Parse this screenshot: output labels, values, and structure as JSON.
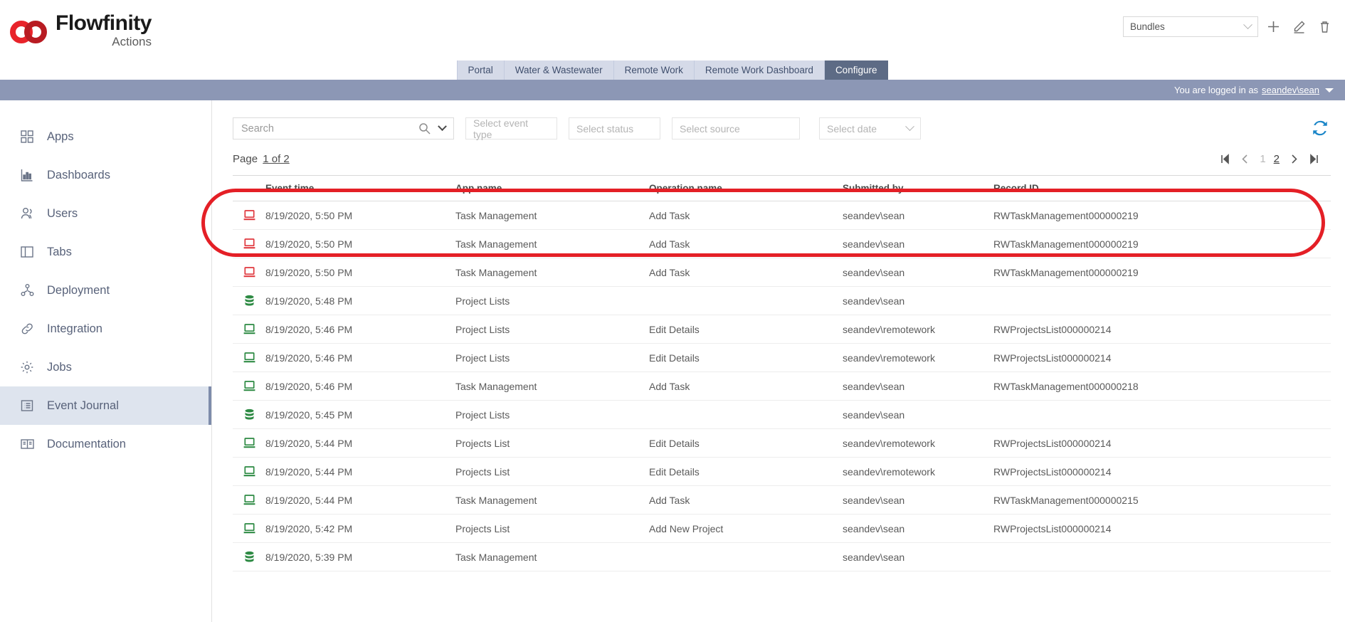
{
  "header": {
    "logo_word": "Flowfinity",
    "logo_sub": "Actions",
    "bundle_label": "Bundles",
    "icons": {
      "add": "plus-icon",
      "edit": "pencil-icon",
      "delete": "trash-icon"
    }
  },
  "tabs": [
    {
      "label": "Portal",
      "active": false
    },
    {
      "label": "Water & Wastewater",
      "active": false
    },
    {
      "label": "Remote Work",
      "active": false
    },
    {
      "label": "Remote Work Dashboard",
      "active": false
    },
    {
      "label": "Configure",
      "active": true
    }
  ],
  "loginbar": {
    "prefix": "You are logged in as",
    "user": "seandev\\sean"
  },
  "sidebar": {
    "items": [
      {
        "label": "Apps",
        "icon": "apps-grid-icon",
        "active": false
      },
      {
        "label": "Dashboards",
        "icon": "bar-chart-icon",
        "active": false
      },
      {
        "label": "Users",
        "icon": "users-icon",
        "active": false
      },
      {
        "label": "Tabs",
        "icon": "layout-panel-icon",
        "active": false
      },
      {
        "label": "Deployment",
        "icon": "deployment-hierarchy-icon",
        "active": false
      },
      {
        "label": "Integration",
        "icon": "link-chain-icon",
        "active": false
      },
      {
        "label": "Jobs",
        "icon": "gear-icon",
        "active": false
      },
      {
        "label": "Event Journal",
        "icon": "list-journal-icon",
        "active": true
      },
      {
        "label": "Documentation",
        "icon": "book-icon",
        "active": false
      }
    ]
  },
  "filters": {
    "search_placeholder": "Search",
    "event_type_placeholder": "Select event type",
    "status_placeholder": "Select status",
    "source_placeholder": "Select source",
    "date_placeholder": "Select date",
    "refresh_icon": "refresh-icon"
  },
  "pagination": {
    "page_label": "Page",
    "page_of": "1 of 2",
    "pages": [
      {
        "label": "1",
        "current": true
      },
      {
        "label": "2",
        "current": false
      }
    ]
  },
  "table": {
    "columns": [
      "",
      "Event time",
      "App name",
      "Operation name",
      "Submitted by",
      "Record ID"
    ],
    "rows": [
      {
        "icon": "desktop-icon",
        "color": "#e0393f",
        "time": "8/19/2020, 5:50 PM",
        "app": "Task Management",
        "operation": "Add Task",
        "submitted_by": "seandev\\sean",
        "record_id": "RWTaskManagement000000219"
      },
      {
        "icon": "desktop-icon",
        "color": "#e0393f",
        "time": "8/19/2020, 5:50 PM",
        "app": "Task Management",
        "operation": "Add Task",
        "submitted_by": "seandev\\sean",
        "record_id": "RWTaskManagement000000219"
      },
      {
        "icon": "desktop-icon",
        "color": "#e0393f",
        "time": "8/19/2020, 5:50 PM",
        "app": "Task Management",
        "operation": "Add Task",
        "submitted_by": "seandev\\sean",
        "record_id": "RWTaskManagement000000219"
      },
      {
        "icon": "database-icon",
        "color": "#2d8a43",
        "time": "8/19/2020, 5:48 PM",
        "app": "Project Lists",
        "operation": "",
        "submitted_by": "seandev\\sean",
        "record_id": ""
      },
      {
        "icon": "desktop-icon",
        "color": "#2d8a43",
        "time": "8/19/2020, 5:46 PM",
        "app": "Project Lists",
        "operation": "Edit Details",
        "submitted_by": "seandev\\remotework",
        "record_id": "RWProjectsList000000214"
      },
      {
        "icon": "desktop-icon",
        "color": "#2d8a43",
        "time": "8/19/2020, 5:46 PM",
        "app": "Project Lists",
        "operation": "Edit Details",
        "submitted_by": "seandev\\remotework",
        "record_id": "RWProjectsList000000214"
      },
      {
        "icon": "desktop-icon",
        "color": "#2d8a43",
        "time": "8/19/2020, 5:46 PM",
        "app": "Task Management",
        "operation": "Add Task",
        "submitted_by": "seandev\\sean",
        "record_id": "RWTaskManagement000000218"
      },
      {
        "icon": "database-icon",
        "color": "#2d8a43",
        "time": "8/19/2020, 5:45 PM",
        "app": "Project Lists",
        "operation": "",
        "submitted_by": "seandev\\sean",
        "record_id": ""
      },
      {
        "icon": "desktop-icon",
        "color": "#2d8a43",
        "time": "8/19/2020, 5:44 PM",
        "app": "Projects List",
        "operation": "Edit Details",
        "submitted_by": "seandev\\remotework",
        "record_id": "RWProjectsList000000214"
      },
      {
        "icon": "desktop-icon",
        "color": "#2d8a43",
        "time": "8/19/2020, 5:44 PM",
        "app": "Projects List",
        "operation": "Edit Details",
        "submitted_by": "seandev\\remotework",
        "record_id": "RWProjectsList000000214"
      },
      {
        "icon": "desktop-icon",
        "color": "#2d8a43",
        "time": "8/19/2020, 5:44 PM",
        "app": "Task Management",
        "operation": "Add Task",
        "submitted_by": "seandev\\sean",
        "record_id": "RWTaskManagement000000215"
      },
      {
        "icon": "desktop-icon",
        "color": "#2d8a43",
        "time": "8/19/2020, 5:42 PM",
        "app": "Projects List",
        "operation": "Add New Project",
        "submitted_by": "seandev\\sean",
        "record_id": "RWProjectsList000000214"
      },
      {
        "icon": "database-icon",
        "color": "#2d8a43",
        "time": "8/19/2020, 5:39 PM",
        "app": "Task Management",
        "operation": "",
        "submitted_by": "seandev\\sean",
        "record_id": ""
      }
    ]
  },
  "annotation": {
    "shape": "rounded-rect",
    "color": "#e41f26",
    "covers_rows": [
      0,
      1,
      2
    ]
  }
}
